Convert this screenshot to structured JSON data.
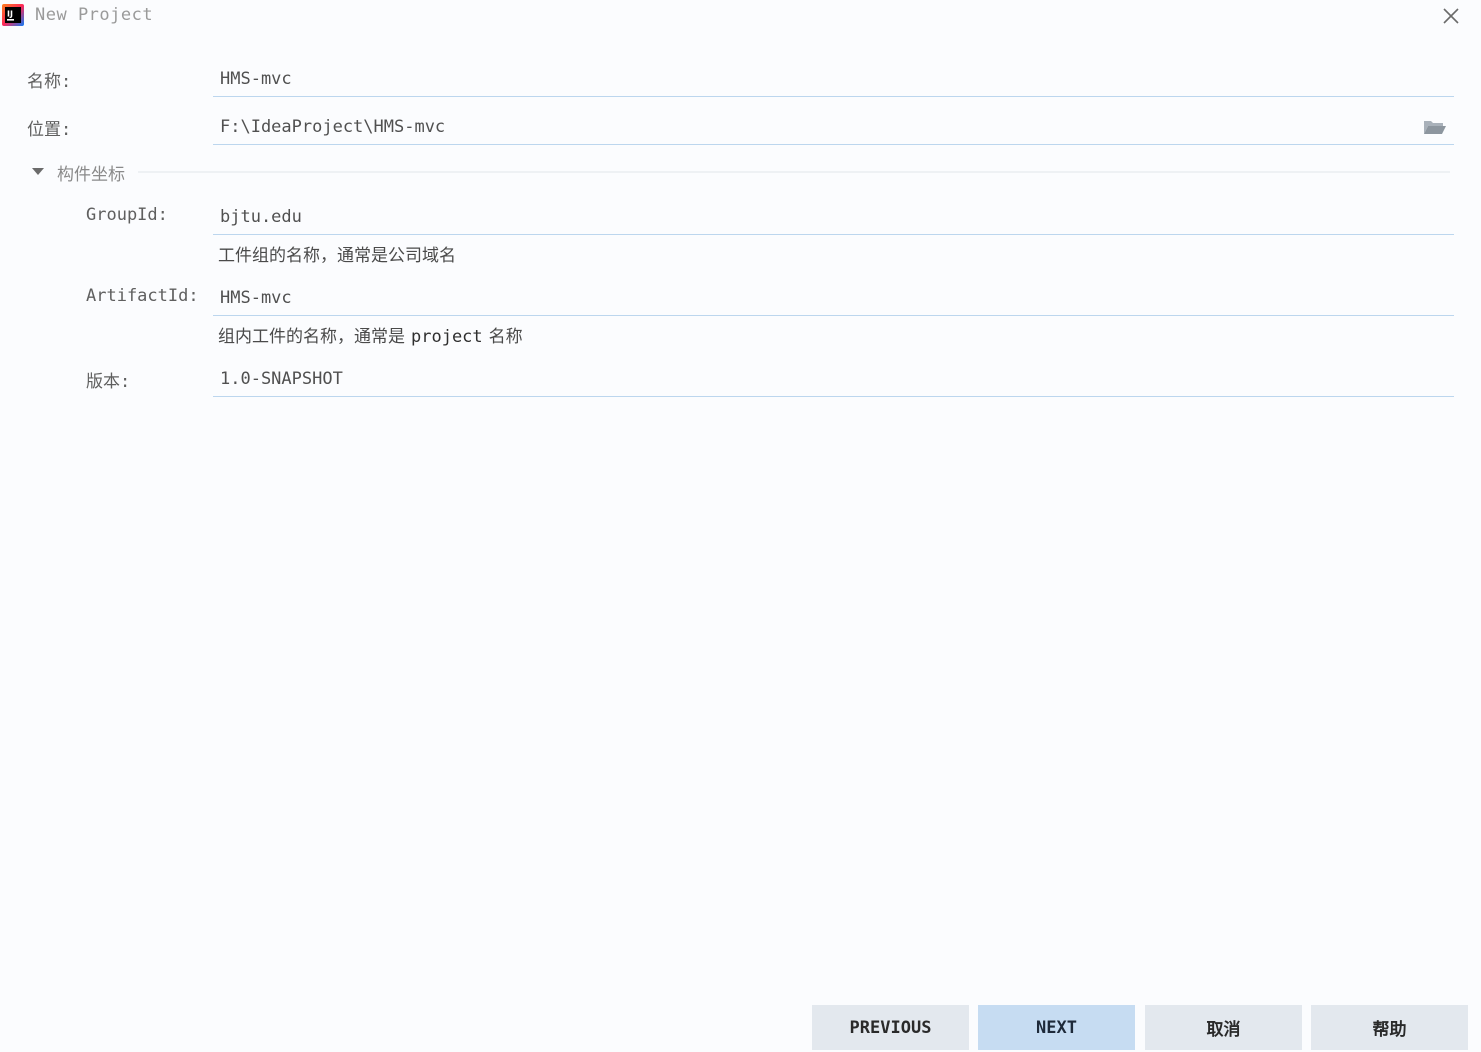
{
  "window": {
    "title": "New Project"
  },
  "form": {
    "name": {
      "label": "名称:",
      "value": "HMS-mvc"
    },
    "location": {
      "label": "位置:",
      "value": "F:\\IdeaProject\\HMS-mvc"
    },
    "section": {
      "title": "构件坐标",
      "expanded": true
    },
    "group_id": {
      "label": "GroupId:",
      "value": "bjtu.edu",
      "hint": "工件组的名称，通常是公司域名"
    },
    "artifact_id": {
      "label": "ArtifactId:",
      "value": "HMS-mvc",
      "hint_prefix": "组内工件的名称，通常是",
      "hint_code": "project",
      "hint_suffix": "名称"
    },
    "version": {
      "label": "版本:",
      "value": "1.0-SNAPSHOT"
    }
  },
  "footer": {
    "previous_label": "PREVIOUS",
    "next_label": "NEXT",
    "cancel_label": "取消",
    "help_label": "帮助"
  },
  "icons": {
    "app": "intellij-idea-logo-icon",
    "close": "close-icon",
    "folder": "folder-open-icon",
    "toggle": "triangle-down-icon"
  },
  "colors": {
    "background": "#fbfcfe",
    "field_underline": "#bcd6ee",
    "primary_button": "#c6dcf2",
    "secondary_button": "#e3e8ee"
  }
}
